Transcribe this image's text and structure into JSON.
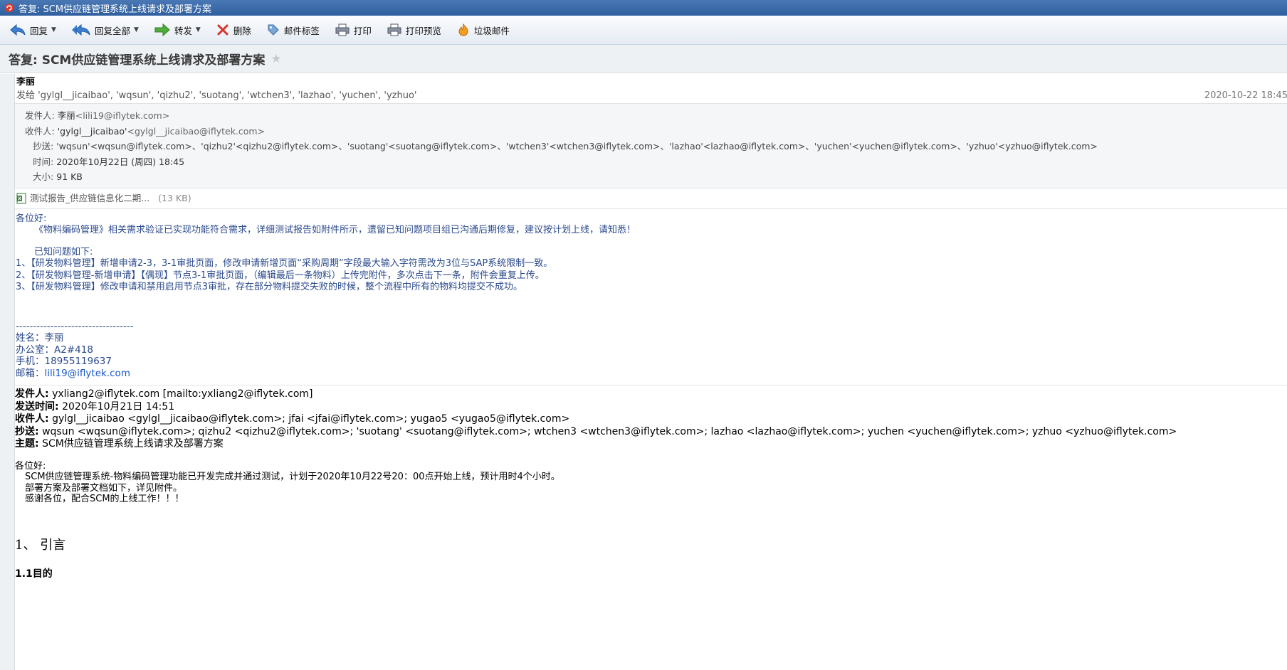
{
  "window": {
    "title": "答复: SCM供应链管理系统上线请求及部署方案"
  },
  "toolbar": {
    "reply": "回复",
    "reply_all": "回复全部",
    "forward": "转发",
    "delete": "删除",
    "tag": "邮件标签",
    "print": "打印",
    "print_preview": "打印预览",
    "junk": "垃圾邮件"
  },
  "subject": "答复: SCM供应链管理系统上线请求及部署方案",
  "message": {
    "sender_name": "李丽",
    "to_summary": "发给 'gylgl__jicaibao', 'wqsun', 'qizhu2', 'suotang', 'wtchen3', 'lazhao', 'yuchen', 'yzhuo'",
    "date_short": "2020-10-22 18:45",
    "from_label": "发件人:",
    "from_value": "李丽",
    "from_email": "<lili19@iflytek.com>",
    "to_label": "收件人:",
    "to_value": "'gylgl__jicaibao'",
    "to_email": "<gylgl__jicaibao@iflytek.com>",
    "cc_label": "抄送:",
    "cc_value": "'wqsun'<wqsun@iflytek.com>、'qizhu2'<qizhu2@iflytek.com>、'suotang'<suotang@iflytek.com>、'wtchen3'<wtchen3@iflytek.com>、'lazhao'<lazhao@iflytek.com>、'yuchen'<yuchen@iflytek.com>、'yzhuo'<yzhuo@iflytek.com>",
    "time_label": "时间:",
    "time_value": "2020年10月22日 (周四) 18:45",
    "size_label": "大小:",
    "size_value": "91 KB"
  },
  "attachment": {
    "name": "测试报告_供应链信息化二期...",
    "size": "(13 KB)"
  },
  "body": {
    "greeting": "各位好:",
    "line1": "《物料编码管理》相关需求验证已实现功能符合需求，详细测试报告如附件所示，遗留已知问题项目组已沟通后期修复，建议按计划上线，请知悉！",
    "issues_title": "已知问题如下:",
    "issues": [
      "1、【研发物料管理】新增申请2-3，3-1审批页面，修改申请新增页面“采购周期”字段最大输入字符需改为3位与SAP系统限制一致。",
      "2、【研发物料管理-新增申请】【偶现】节点3-1审批页面，（编辑最后一条物料）上传完附件，多次点击下一条，附件会重复上传。",
      "3、【研发物料管理】修改申请和禁用启用节点3审批，存在部分物料提交失败的时候，整个流程中所有的物料均提交不成功。"
    ]
  },
  "signature": {
    "divider": "----------------------------------",
    "name": "姓名：李丽",
    "office": "办公室：A2#418",
    "phone": "手机：18955119637",
    "email_label": "邮箱：",
    "email": "lili19@iflytek.com"
  },
  "quoted": {
    "from_label": "发件人:",
    "from_value": "yxliang2@iflytek.com [mailto:yxliang2@iflytek.com]",
    "sent_label": "发送时间:",
    "sent_value": "2020年10月21日 14:51",
    "to_label": "收件人:",
    "to_value": "gylgl__jicaibao <gylgl__jicaibao@iflytek.com>; jfai <jfai@iflytek.com>; yugao5 <yugao5@iflytek.com>",
    "cc_label": "抄送:",
    "cc_value": "wqsun <wqsun@iflytek.com>; qizhu2 <qizhu2@iflytek.com>; 'suotang' <suotang@iflytek.com>; wtchen3 <wtchen3@iflytek.com>; lazhao <lazhao@iflytek.com>; yuchen <yuchen@iflytek.com>; yzhuo <yzhuo@iflytek.com>",
    "subject_label": "主题:",
    "subject_value": "SCM供应链管理系统上线请求及部署方案",
    "greeting": "各位好:",
    "lines": [
      "SCM供应链管理系统-物料编码管理功能已开发完成并通过测试，计划于2020年10月22号20：00点开始上线，预计用时4个小时。",
      "部署方案及部署文档如下，详见附件。",
      "感谢各位，配合SCM的上线工作！！！"
    ],
    "heading1": "1、  引言",
    "heading2": "1.1目的"
  },
  "colors": {
    "titlebar": "#2f5e9e",
    "link": "#1a56c6",
    "body_text": "#2b4a8c"
  }
}
